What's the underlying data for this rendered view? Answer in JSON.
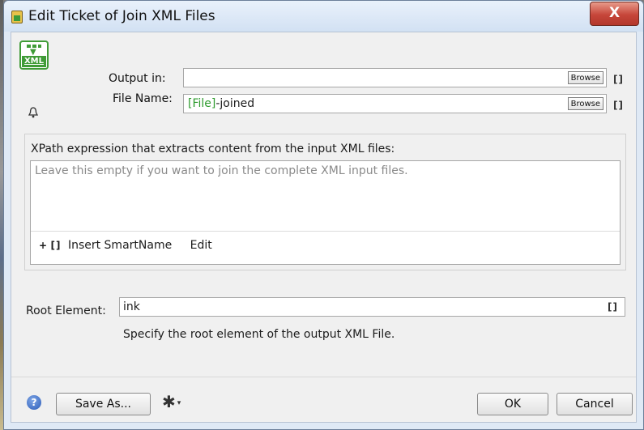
{
  "window": {
    "title": "Edit Ticket of Join XML Files",
    "close_glyph": "X"
  },
  "icons": {
    "app_icon": "tool-icon",
    "xml_label": "XML",
    "bell": "bell-icon",
    "help": "help-icon",
    "gear": "gear-icon"
  },
  "output": {
    "output_in_label": "Output in:",
    "output_in_value": "",
    "file_name_label": "File Name:",
    "file_name_token": "[File]",
    "file_name_suffix": "-joined",
    "browse_label": "Browse",
    "smartname_glyph": "[]"
  },
  "xpath": {
    "label": "XPath expression that extracts content from the input XML files:",
    "placeholder": "Leave this empty if you want to join the complete XML input files.",
    "insert_plus": "+",
    "insert_bracket": "[]",
    "insert_label": "Insert SmartName",
    "edit_label": "Edit"
  },
  "root": {
    "label": "Root Element:",
    "value": "ink",
    "smartname_glyph": "[]",
    "hint": "Specify the root element of the output XML File."
  },
  "footer": {
    "help_glyph": "?",
    "save_as_label": "Save As...",
    "gear_caret": "▾",
    "ok_label": "OK",
    "cancel_label": "Cancel"
  }
}
